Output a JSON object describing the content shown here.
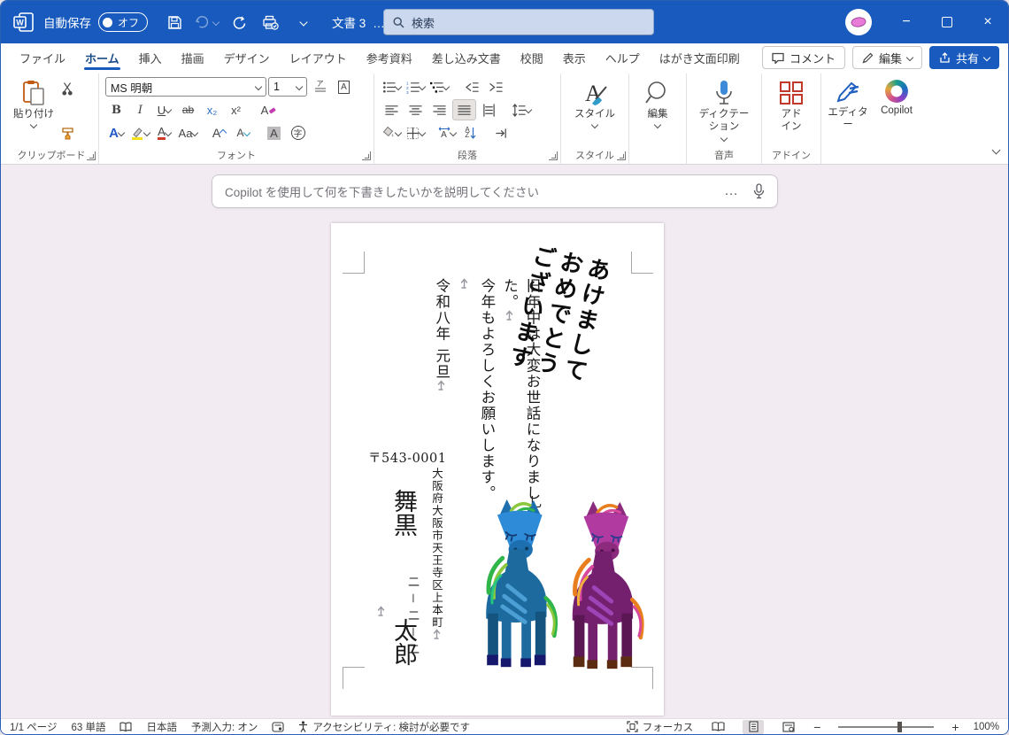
{
  "icons": {
    "minimize": "−",
    "close": "×",
    "ellipsis": "…"
  },
  "titlebar": {
    "autosave_label": "自動保存",
    "autosave_state": "オフ",
    "doc_title": "文書 3",
    "title_dots": "…",
    "search_placeholder": "検索"
  },
  "tabs": [
    "ファイル",
    "ホーム",
    "挿入",
    "描画",
    "デザイン",
    "レイアウト",
    "参考資料",
    "差し込み文書",
    "校閲",
    "表示",
    "ヘルプ",
    "はがき文面印刷"
  ],
  "actions": {
    "comments": "コメント",
    "editing": "編集",
    "share": "共有"
  },
  "ribbon": {
    "groups": {
      "clipboard": "クリップボード",
      "font": "フォント",
      "paragraph": "段落",
      "styles": "スタイル",
      "voice": "音声",
      "addins": "アドイン"
    },
    "paste": "貼り付け",
    "font_name": "MS 明朝",
    "font_size": "1",
    "letters": {
      "bold": "B",
      "italic": "I",
      "underline": "U",
      "strikethrough": "ab",
      "subscript": "x₂",
      "superscript": "x²",
      "clear_format": "A",
      "text_effects": "A",
      "font_color": "A",
      "change_case": "Aa",
      "grow": "A",
      "shrink": "A",
      "shading": "A",
      "enclose": "字",
      "ruby": "ア",
      "scale": "A",
      "sort_a": "A",
      "sort_z": "Z"
    },
    "buttons": {
      "styles": "スタイル",
      "editing": "編集",
      "dictation": "ディクテーション",
      "addins": "アドイン",
      "editor": "エディター",
      "copilot": "Copilot"
    }
  },
  "copilot_bar": {
    "placeholder": "Copilot を使用して何を下書きしたいかを説明してください"
  },
  "document": {
    "greeting": [
      "あけまして",
      "おめでとう",
      "ございます"
    ],
    "body_lines": [
      "旧年中は大変お世話になりまし",
      "た。",
      "今年もよろしくお願いします。",
      "令和八年 元旦"
    ],
    "postal_code": "〒543-0001",
    "address_line1": "大阪府大阪市天王寺区上本町",
    "address_line2": "二－二－二",
    "sender_name_1": "舞黒",
    "sender_name_2": "太郎",
    "linebreak_glyph": "乚",
    "horses": {
      "left": {
        "head": "#2E8BD8",
        "head_dark": "#1D6FB0",
        "body": "#1C6A9E",
        "body_dark": "#14547F",
        "hoof": "#16186E",
        "mane": "#2FB54A",
        "mane2": "#8CC83E",
        "stripe": "#55A8DE"
      },
      "right": {
        "head": "#B13AA0",
        "head_dark": "#8C2B7E",
        "body": "#74206F",
        "body_dark": "#5A1754",
        "hoof": "#5B2B12",
        "mane": "#E87E1E",
        "mane2": "#D8489C",
        "stripe": "#A44BC4"
      }
    }
  },
  "statusbar": {
    "page": "1/1 ページ",
    "words": "63 単語",
    "language": "日本語",
    "ime": "予測入力: オン",
    "accessibility": "アクセシビリティ: 検討が必要です",
    "focus": "フォーカス",
    "zoom": "100%",
    "zoom_minus": "−",
    "zoom_plus": "+"
  },
  "colors": {
    "titlebar": "#185ABD",
    "accent": "#185ABD",
    "app_bg": "#F2ECF2"
  }
}
